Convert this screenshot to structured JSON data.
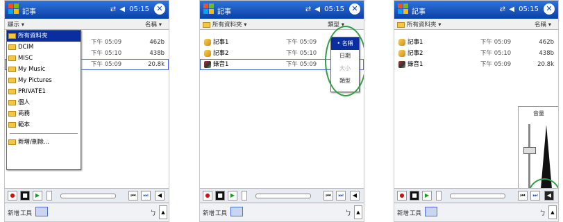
{
  "app_title": "記事",
  "clock": "05:15",
  "status_icons": "⇄ ◀",
  "close_label": "✕",
  "menubar": {
    "new": "新增",
    "tools": "工具",
    "ime": "ㄅ",
    "scroll": "▲"
  },
  "player": {
    "record": "●",
    "stop": "■",
    "play": "▶",
    "prev": "⏮",
    "next": "⏭",
    "volume": "◀"
  },
  "screen1": {
    "folder_label": "顯示 ▾",
    "sort_label": "名稱 ▾",
    "rows": [
      {
        "date": "下午 05:09",
        "size": "462b"
      },
      {
        "date": "下午 05:10",
        "size": "438b"
      },
      {
        "date": "下午 05:09",
        "size": "20.8k"
      }
    ],
    "dropdown": [
      "所有資料夾",
      "DCIM",
      "MISC",
      "My Music",
      "My Pictures",
      "PRIVATE1",
      "個人",
      "商務",
      "範本"
    ],
    "dropdown_footer": "新增/刪除..."
  },
  "screen2": {
    "folder_label": "所有資料夾 ▾",
    "sort_label": "類型 ▾",
    "rows": [
      {
        "name": "記事1",
        "date": "下午 05:09",
        "size": "462b"
      },
      {
        "name": "記事2",
        "date": "下午 05:10",
        "size": "438b"
      },
      {
        "name": "錄音1",
        "date": "下午 05:09",
        "size": "20.8k"
      }
    ],
    "sort_menu": [
      "• 名稱",
      "日期",
      "大小",
      "類型"
    ]
  },
  "screen3": {
    "folder_label": "所有資料夾 ▾",
    "sort_label": "名稱 ▾",
    "rows": [
      {
        "name": "記事1",
        "date": "下午 05:09",
        "size": "462b"
      },
      {
        "name": "記事2",
        "date": "下午 05:10",
        "size": "438b"
      },
      {
        "name": "錄音1",
        "date": "下午 05:09",
        "size": "20.8k"
      }
    ],
    "volume_title": "音量",
    "volume_level": 0.6
  },
  "colors": {
    "titlebar": "#0b3fa9",
    "highlight": "#0a2ea0",
    "callout": "#2f9e44"
  }
}
